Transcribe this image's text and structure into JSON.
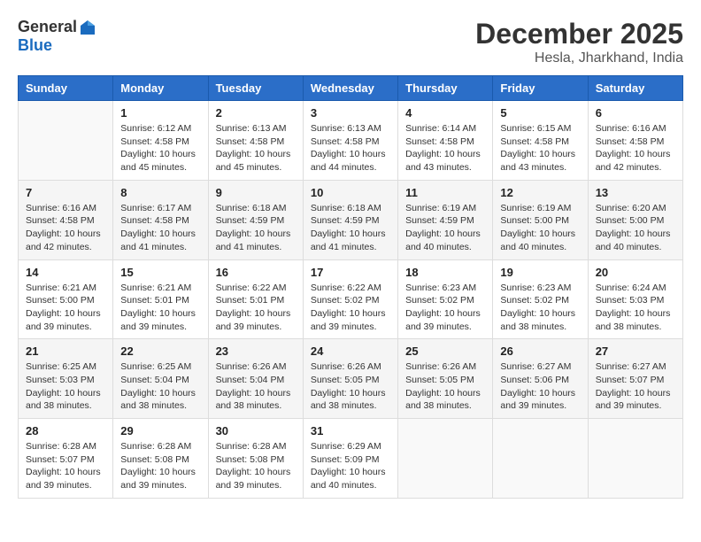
{
  "header": {
    "logo_general": "General",
    "logo_blue": "Blue",
    "month_title": "December 2025",
    "location": "Hesla, Jharkhand, India"
  },
  "weekdays": [
    "Sunday",
    "Monday",
    "Tuesday",
    "Wednesday",
    "Thursday",
    "Friday",
    "Saturday"
  ],
  "weeks": [
    [
      {
        "day": "",
        "sunrise": "",
        "sunset": "",
        "daylight": ""
      },
      {
        "day": "1",
        "sunrise": "Sunrise: 6:12 AM",
        "sunset": "Sunset: 4:58 PM",
        "daylight": "Daylight: 10 hours and 45 minutes."
      },
      {
        "day": "2",
        "sunrise": "Sunrise: 6:13 AM",
        "sunset": "Sunset: 4:58 PM",
        "daylight": "Daylight: 10 hours and 45 minutes."
      },
      {
        "day": "3",
        "sunrise": "Sunrise: 6:13 AM",
        "sunset": "Sunset: 4:58 PM",
        "daylight": "Daylight: 10 hours and 44 minutes."
      },
      {
        "day": "4",
        "sunrise": "Sunrise: 6:14 AM",
        "sunset": "Sunset: 4:58 PM",
        "daylight": "Daylight: 10 hours and 43 minutes."
      },
      {
        "day": "5",
        "sunrise": "Sunrise: 6:15 AM",
        "sunset": "Sunset: 4:58 PM",
        "daylight": "Daylight: 10 hours and 43 minutes."
      },
      {
        "day": "6",
        "sunrise": "Sunrise: 6:16 AM",
        "sunset": "Sunset: 4:58 PM",
        "daylight": "Daylight: 10 hours and 42 minutes."
      }
    ],
    [
      {
        "day": "7",
        "sunrise": "Sunrise: 6:16 AM",
        "sunset": "Sunset: 4:58 PM",
        "daylight": "Daylight: 10 hours and 42 minutes."
      },
      {
        "day": "8",
        "sunrise": "Sunrise: 6:17 AM",
        "sunset": "Sunset: 4:58 PM",
        "daylight": "Daylight: 10 hours and 41 minutes."
      },
      {
        "day": "9",
        "sunrise": "Sunrise: 6:18 AM",
        "sunset": "Sunset: 4:59 PM",
        "daylight": "Daylight: 10 hours and 41 minutes."
      },
      {
        "day": "10",
        "sunrise": "Sunrise: 6:18 AM",
        "sunset": "Sunset: 4:59 PM",
        "daylight": "Daylight: 10 hours and 41 minutes."
      },
      {
        "day": "11",
        "sunrise": "Sunrise: 6:19 AM",
        "sunset": "Sunset: 4:59 PM",
        "daylight": "Daylight: 10 hours and 40 minutes."
      },
      {
        "day": "12",
        "sunrise": "Sunrise: 6:19 AM",
        "sunset": "Sunset: 5:00 PM",
        "daylight": "Daylight: 10 hours and 40 minutes."
      },
      {
        "day": "13",
        "sunrise": "Sunrise: 6:20 AM",
        "sunset": "Sunset: 5:00 PM",
        "daylight": "Daylight: 10 hours and 40 minutes."
      }
    ],
    [
      {
        "day": "14",
        "sunrise": "Sunrise: 6:21 AM",
        "sunset": "Sunset: 5:00 PM",
        "daylight": "Daylight: 10 hours and 39 minutes."
      },
      {
        "day": "15",
        "sunrise": "Sunrise: 6:21 AM",
        "sunset": "Sunset: 5:01 PM",
        "daylight": "Daylight: 10 hours and 39 minutes."
      },
      {
        "day": "16",
        "sunrise": "Sunrise: 6:22 AM",
        "sunset": "Sunset: 5:01 PM",
        "daylight": "Daylight: 10 hours and 39 minutes."
      },
      {
        "day": "17",
        "sunrise": "Sunrise: 6:22 AM",
        "sunset": "Sunset: 5:02 PM",
        "daylight": "Daylight: 10 hours and 39 minutes."
      },
      {
        "day": "18",
        "sunrise": "Sunrise: 6:23 AM",
        "sunset": "Sunset: 5:02 PM",
        "daylight": "Daylight: 10 hours and 39 minutes."
      },
      {
        "day": "19",
        "sunrise": "Sunrise: 6:23 AM",
        "sunset": "Sunset: 5:02 PM",
        "daylight": "Daylight: 10 hours and 38 minutes."
      },
      {
        "day": "20",
        "sunrise": "Sunrise: 6:24 AM",
        "sunset": "Sunset: 5:03 PM",
        "daylight": "Daylight: 10 hours and 38 minutes."
      }
    ],
    [
      {
        "day": "21",
        "sunrise": "Sunrise: 6:25 AM",
        "sunset": "Sunset: 5:03 PM",
        "daylight": "Daylight: 10 hours and 38 minutes."
      },
      {
        "day": "22",
        "sunrise": "Sunrise: 6:25 AM",
        "sunset": "Sunset: 5:04 PM",
        "daylight": "Daylight: 10 hours and 38 minutes."
      },
      {
        "day": "23",
        "sunrise": "Sunrise: 6:26 AM",
        "sunset": "Sunset: 5:04 PM",
        "daylight": "Daylight: 10 hours and 38 minutes."
      },
      {
        "day": "24",
        "sunrise": "Sunrise: 6:26 AM",
        "sunset": "Sunset: 5:05 PM",
        "daylight": "Daylight: 10 hours and 38 minutes."
      },
      {
        "day": "25",
        "sunrise": "Sunrise: 6:26 AM",
        "sunset": "Sunset: 5:05 PM",
        "daylight": "Daylight: 10 hours and 38 minutes."
      },
      {
        "day": "26",
        "sunrise": "Sunrise: 6:27 AM",
        "sunset": "Sunset: 5:06 PM",
        "daylight": "Daylight: 10 hours and 39 minutes."
      },
      {
        "day": "27",
        "sunrise": "Sunrise: 6:27 AM",
        "sunset": "Sunset: 5:07 PM",
        "daylight": "Daylight: 10 hours and 39 minutes."
      }
    ],
    [
      {
        "day": "28",
        "sunrise": "Sunrise: 6:28 AM",
        "sunset": "Sunset: 5:07 PM",
        "daylight": "Daylight: 10 hours and 39 minutes."
      },
      {
        "day": "29",
        "sunrise": "Sunrise: 6:28 AM",
        "sunset": "Sunset: 5:08 PM",
        "daylight": "Daylight: 10 hours and 39 minutes."
      },
      {
        "day": "30",
        "sunrise": "Sunrise: 6:28 AM",
        "sunset": "Sunset: 5:08 PM",
        "daylight": "Daylight: 10 hours and 39 minutes."
      },
      {
        "day": "31",
        "sunrise": "Sunrise: 6:29 AM",
        "sunset": "Sunset: 5:09 PM",
        "daylight": "Daylight: 10 hours and 40 minutes."
      },
      {
        "day": "",
        "sunrise": "",
        "sunset": "",
        "daylight": ""
      },
      {
        "day": "",
        "sunrise": "",
        "sunset": "",
        "daylight": ""
      },
      {
        "day": "",
        "sunrise": "",
        "sunset": "",
        "daylight": ""
      }
    ]
  ]
}
